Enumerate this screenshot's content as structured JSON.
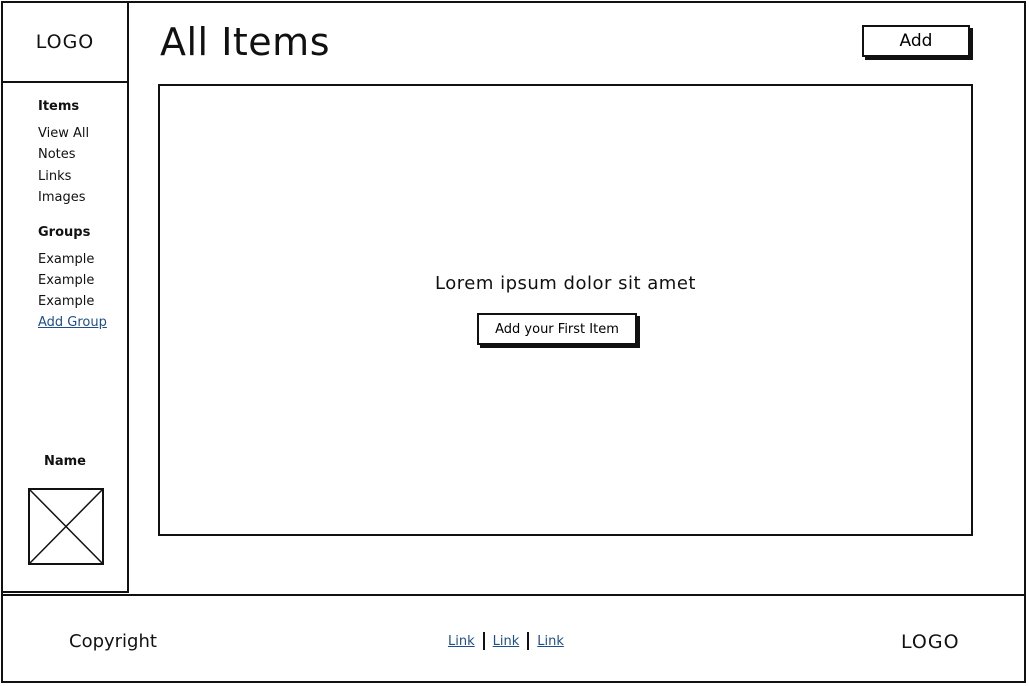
{
  "sidebar": {
    "logo": "LOGO",
    "items_title": "Items",
    "items": [
      {
        "label": "View All"
      },
      {
        "label": "Notes"
      },
      {
        "label": "Links"
      },
      {
        "label": "Images"
      }
    ],
    "groups_title": "Groups",
    "groups": [
      {
        "label": "Example"
      },
      {
        "label": "Example"
      },
      {
        "label": "Example"
      }
    ],
    "add_group_label": "Add Group",
    "user_name": "Name",
    "avatar_icon": "image-placeholder-icon"
  },
  "header": {
    "title": "All Items",
    "add_label": "Add"
  },
  "main": {
    "empty_message": "Lorem ipsum dolor sit amet",
    "first_item_label": "Add your First Item"
  },
  "footer": {
    "copyright": "Copyright",
    "links": [
      {
        "label": "Link"
      },
      {
        "label": "Link"
      },
      {
        "label": "Link"
      }
    ],
    "logo": "LOGO"
  },
  "colors": {
    "stroke": "#111111",
    "link": "#1f4e8c",
    "background": "#ffffff"
  }
}
